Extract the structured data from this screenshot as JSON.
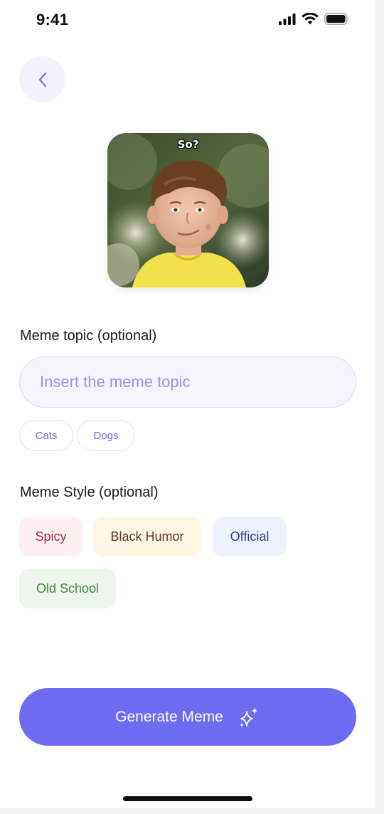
{
  "status_bar": {
    "time": "9:41"
  },
  "meme": {
    "caption": "So?"
  },
  "topic": {
    "label": "Meme topic (optional)",
    "placeholder": "Insert the meme topic",
    "value": "",
    "suggestions": [
      "Cats",
      "Dogs"
    ]
  },
  "style": {
    "label": "Meme Style (optional)",
    "options": [
      {
        "label": "Spicy",
        "bg": "#fdf1f4",
        "color": "#a02a4a"
      },
      {
        "label": "Black Humor",
        "bg": "#fdf7e4",
        "color": "#5a3a16"
      },
      {
        "label": "Official",
        "bg": "#eef2fd",
        "color": "#2b3a8e"
      },
      {
        "label": "Old School",
        "bg": "#eef5ec",
        "color": "#3f8a3a"
      }
    ]
  },
  "generate": {
    "label": "Generate Meme"
  },
  "colors": {
    "accent": "#6f6bf0",
    "back_button_bg": "#f4f2fd"
  }
}
